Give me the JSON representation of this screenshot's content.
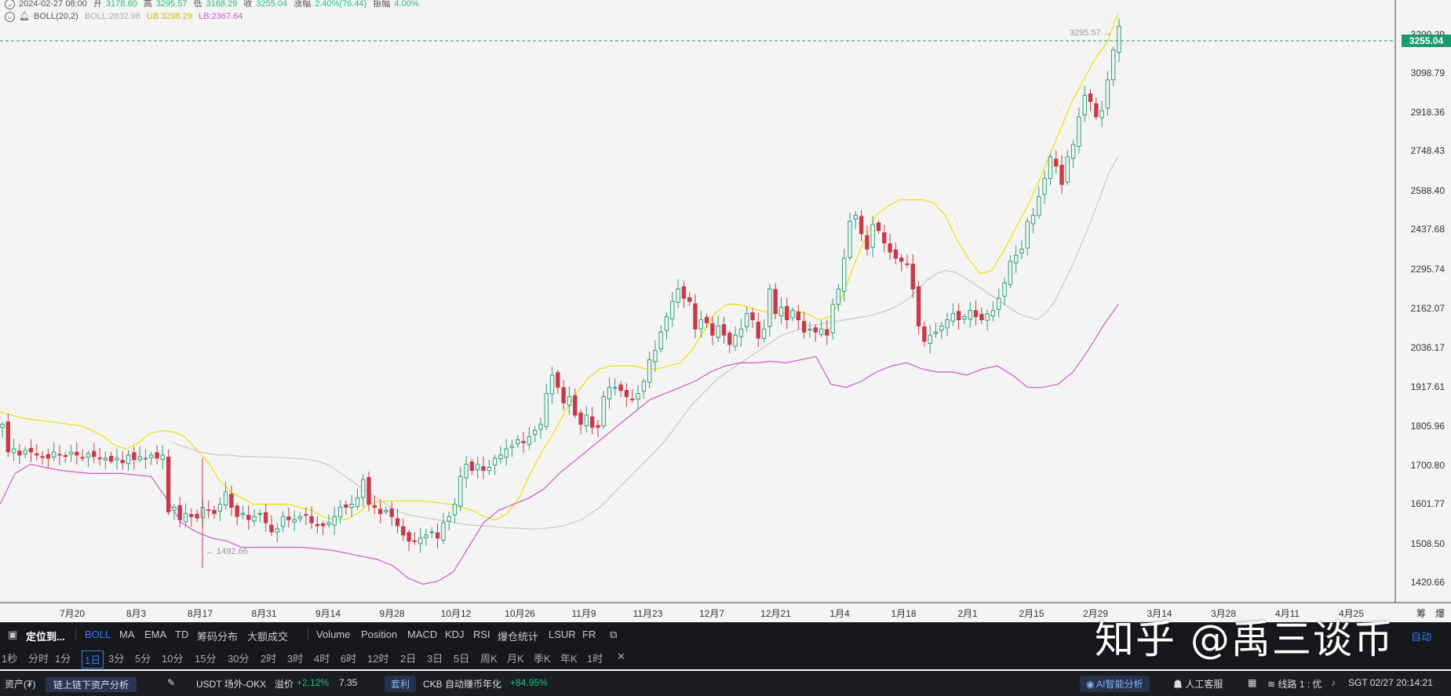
{
  "info_line1": {
    "date": "2024-02-27 08:00",
    "open_label": "开",
    "open": "3178.60",
    "high_label": "高",
    "high": "3295.57",
    "low_label": "低",
    "low": "3168.29",
    "close_label": "收",
    "close": "3255.04",
    "change_label": "涨幅",
    "change": "2.40%(76.44)",
    "amp_label": "振幅",
    "amp": "4.00%"
  },
  "info_line2": {
    "indicator": "BOLL(20,2)",
    "boll": "BOLL:2832.96",
    "ub": "UB:3298.29",
    "lb": "LB:2367.64"
  },
  "chart_data": {
    "type": "candlestick",
    "y_ticks": [
      "3290.29",
      "3098.79",
      "2918.36",
      "2748.43",
      "2588.40",
      "2437.68",
      "2295.74",
      "2162.07",
      "2036.17",
      "1917.61",
      "1805.96",
      "1700.80",
      "1601.77",
      "1508.50",
      "1420.66"
    ],
    "x_ticks": [
      "7月20",
      "8月3",
      "8月17",
      "8月31",
      "9月14",
      "9月28",
      "10月12",
      "10月26",
      "11月9",
      "11月23",
      "12月7",
      "12月21",
      "1月4",
      "1月18",
      "2月1",
      "2月15",
      "2月29",
      "3月14",
      "3月28",
      "4月11",
      "4月25"
    ],
    "current_price": "3255.04",
    "max_marker": "3295.57",
    "min_marker": "1492.66",
    "ylim": [
      1380,
      3340
    ],
    "close_path": [
      1960,
      1870,
      1880,
      1860,
      1875,
      1870,
      1860,
      1855,
      1850,
      1870,
      1860,
      1855,
      1870,
      1860,
      1850,
      1865,
      1855,
      1850,
      1850,
      1840,
      1850,
      1835,
      1860,
      1845,
      1855,
      1850,
      1860,
      1850,
      1860,
      1675,
      1690,
      1650,
      1670,
      1660,
      1655,
      1690,
      1680,
      1670,
      1700,
      1740,
      1690,
      1660,
      1670,
      1650,
      1660,
      1670,
      1640,
      1610,
      1620,
      1660,
      1650,
      1650,
      1660,
      1665,
      1640,
      1630,
      1630,
      1640,
      1660,
      1690,
      1690,
      1700,
      1720,
      1780,
      1700,
      1690,
      1670,
      1680,
      1660,
      1630,
      1600,
      1580,
      1580,
      1590,
      1600,
      1610,
      1590,
      1640,
      1660,
      1700,
      1790,
      1830,
      1810,
      1830,
      1810,
      1820,
      1850,
      1860,
      1880,
      1890,
      1910,
      1900,
      1920,
      1940,
      1960,
      2060,
      2120,
      2080,
      2030,
      2050,
      1990,
      1960,
      1990,
      1950,
      1950,
      2050,
      2080,
      2080,
      2070,
      2050,
      2040,
      2060,
      2100,
      2170,
      2200,
      2260,
      2310,
      2360,
      2400,
      2370,
      2360,
      2270,
      2300,
      2290,
      2250,
      2280,
      2250,
      2220,
      2250,
      2270,
      2320,
      2300,
      2240,
      2270,
      2400,
      2320,
      2340,
      2300,
      2330,
      2300,
      2260,
      2270,
      2260,
      2270,
      2250,
      2350,
      2400,
      2500,
      2620,
      2640,
      2580,
      2530,
      2610,
      2590,
      2550,
      2520,
      2500,
      2490,
      2480,
      2400,
      2280,
      2230,
      2250,
      2260,
      2280,
      2300,
      2320,
      2300,
      2310,
      2330,
      2310,
      2300,
      2320,
      2330,
      2370,
      2420,
      2490,
      2510,
      2530,
      2620,
      2640,
      2700,
      2760,
      2830,
      2800,
      2740,
      2830,
      2870,
      2960,
      3030,
      3010,
      2960,
      2980,
      3080,
      3178,
      3255
    ],
    "ma_path": [
      1900,
      1890,
      1880,
      1870,
      1865,
      1860,
      1860,
      1857,
      1855,
      1855,
      1854,
      1853,
      1852,
      1850,
      1848,
      1845,
      1840,
      1830,
      1810,
      1790,
      1770,
      1750,
      1730,
      1710,
      1690,
      1675,
      1665,
      1660,
      1655,
      1650,
      1645,
      1640,
      1635,
      1632,
      1630,
      1628,
      1625,
      1623,
      1622,
      1620,
      1620,
      1622,
      1625,
      1630,
      1640,
      1650,
      1670,
      1690,
      1720,
      1750,
      1780,
      1810,
      1840,
      1870,
      1900,
      1940,
      1980,
      2020,
      2050,
      2080,
      2110,
      2130,
      2150,
      2170,
      2190,
      2210,
      2230,
      2250,
      2260,
      2270,
      2280,
      2285,
      2290,
      2295,
      2300,
      2305,
      2310,
      2315,
      2325,
      2335,
      2350,
      2370,
      2400,
      2430,
      2450,
      2460,
      2455,
      2440,
      2420,
      2400,
      2380,
      2360,
      2340,
      2320,
      2310,
      2300,
      2320,
      2360,
      2420,
      2480,
      2550,
      2620,
      2700,
      2780,
      2832
    ],
    "ub_path": [
      2000,
      1990,
      1980,
      1975,
      1970,
      1965,
      1960,
      1955,
      1940,
      1920,
      1890,
      1880,
      1900,
      1930,
      1940,
      1935,
      1920,
      1880,
      1840,
      1780,
      1740,
      1720,
      1700,
      1700,
      1700,
      1700,
      1690,
      1680,
      1660,
      1650,
      1650,
      1670,
      1700,
      1710,
      1710,
      1710,
      1710,
      1710,
      1705,
      1700,
      1690,
      1680,
      1660,
      1650,
      1670,
      1720,
      1800,
      1870,
      1930,
      2000,
      2060,
      2110,
      2140,
      2150,
      2150,
      2150,
      2140,
      2140,
      2150,
      2160,
      2200,
      2260,
      2320,
      2350,
      2350,
      2340,
      2330,
      2320,
      2320,
      2330,
      2320,
      2300,
      2310,
      2370,
      2470,
      2560,
      2640,
      2670,
      2690,
      2690,
      2690,
      2680,
      2640,
      2560,
      2500,
      2450,
      2460,
      2520,
      2590,
      2660,
      2740,
      2830,
      2920,
      3010,
      3080,
      3150,
      3200,
      3298
    ],
    "lb_path": [
      1700,
      1800,
      1830,
      1820,
      1810,
      1805,
      1800,
      1800,
      1800,
      1795,
      1790,
      1720,
      1640,
      1610,
      1590,
      1580,
      1560,
      1560,
      1560,
      1560,
      1560,
      1555,
      1550,
      1540,
      1530,
      1520,
      1500,
      1460,
      1440,
      1450,
      1480,
      1560,
      1640,
      1680,
      1700,
      1720,
      1750,
      1800,
      1840,
      1880,
      1920,
      1960,
      2000,
      2040,
      2060,
      2080,
      2100,
      2130,
      2150,
      2160,
      2160,
      2165,
      2160,
      2170,
      2180,
      2090,
      2080,
      2100,
      2130,
      2150,
      2160,
      2140,
      2130,
      2130,
      2120,
      2140,
      2150,
      2120,
      2080,
      2080,
      2090,
      2130,
      2200,
      2280,
      2350
    ],
    "price_up_color": "#2e9e7e",
    "price_down_color": "#c73b48",
    "ub_color": "#f0e000",
    "lb_color": "#d158c8",
    "mid_color": "#c8c8c8"
  },
  "toolbar1": {
    "locate": "定位到...",
    "items": [
      "BOLL",
      "MA",
      "EMA",
      "TD",
      "筹码分布",
      "大额成交"
    ],
    "items2": [
      "Volume",
      "Position",
      "MACD",
      "KDJ",
      "RSI",
      "爆仓统计",
      "LSUR",
      "FR"
    ],
    "right": "自动"
  },
  "toolbar2": {
    "intervals": [
      "1秒",
      "分时",
      "1分",
      "1日",
      "3分",
      "5分",
      "10分",
      "15分",
      "30分",
      "2时",
      "3时",
      "4时",
      "6时",
      "12时",
      "2日",
      "3日",
      "5日",
      "周K",
      "月K",
      "季K",
      "年K",
      "1时"
    ],
    "active": "1日"
  },
  "statusbar": {
    "assets": "资产(₮)",
    "analysis": "链上链下资产分析",
    "pair": "USDT 场外-OKX",
    "premium_label": "溢价",
    "premium": "+2.12%",
    "price": "7.35",
    "arb": "套利",
    "ckb": "CKB 自动赚币年化",
    "ckb_rate": "+84.95%",
    "ai": "AI智能分析",
    "service": "人工客服",
    "line": "线路 1 : 优",
    "time": "SGT 02/27 20:14:21"
  },
  "watermark": "知乎 @禹三谈币",
  "right_labels": [
    "筹",
    "爆"
  ]
}
